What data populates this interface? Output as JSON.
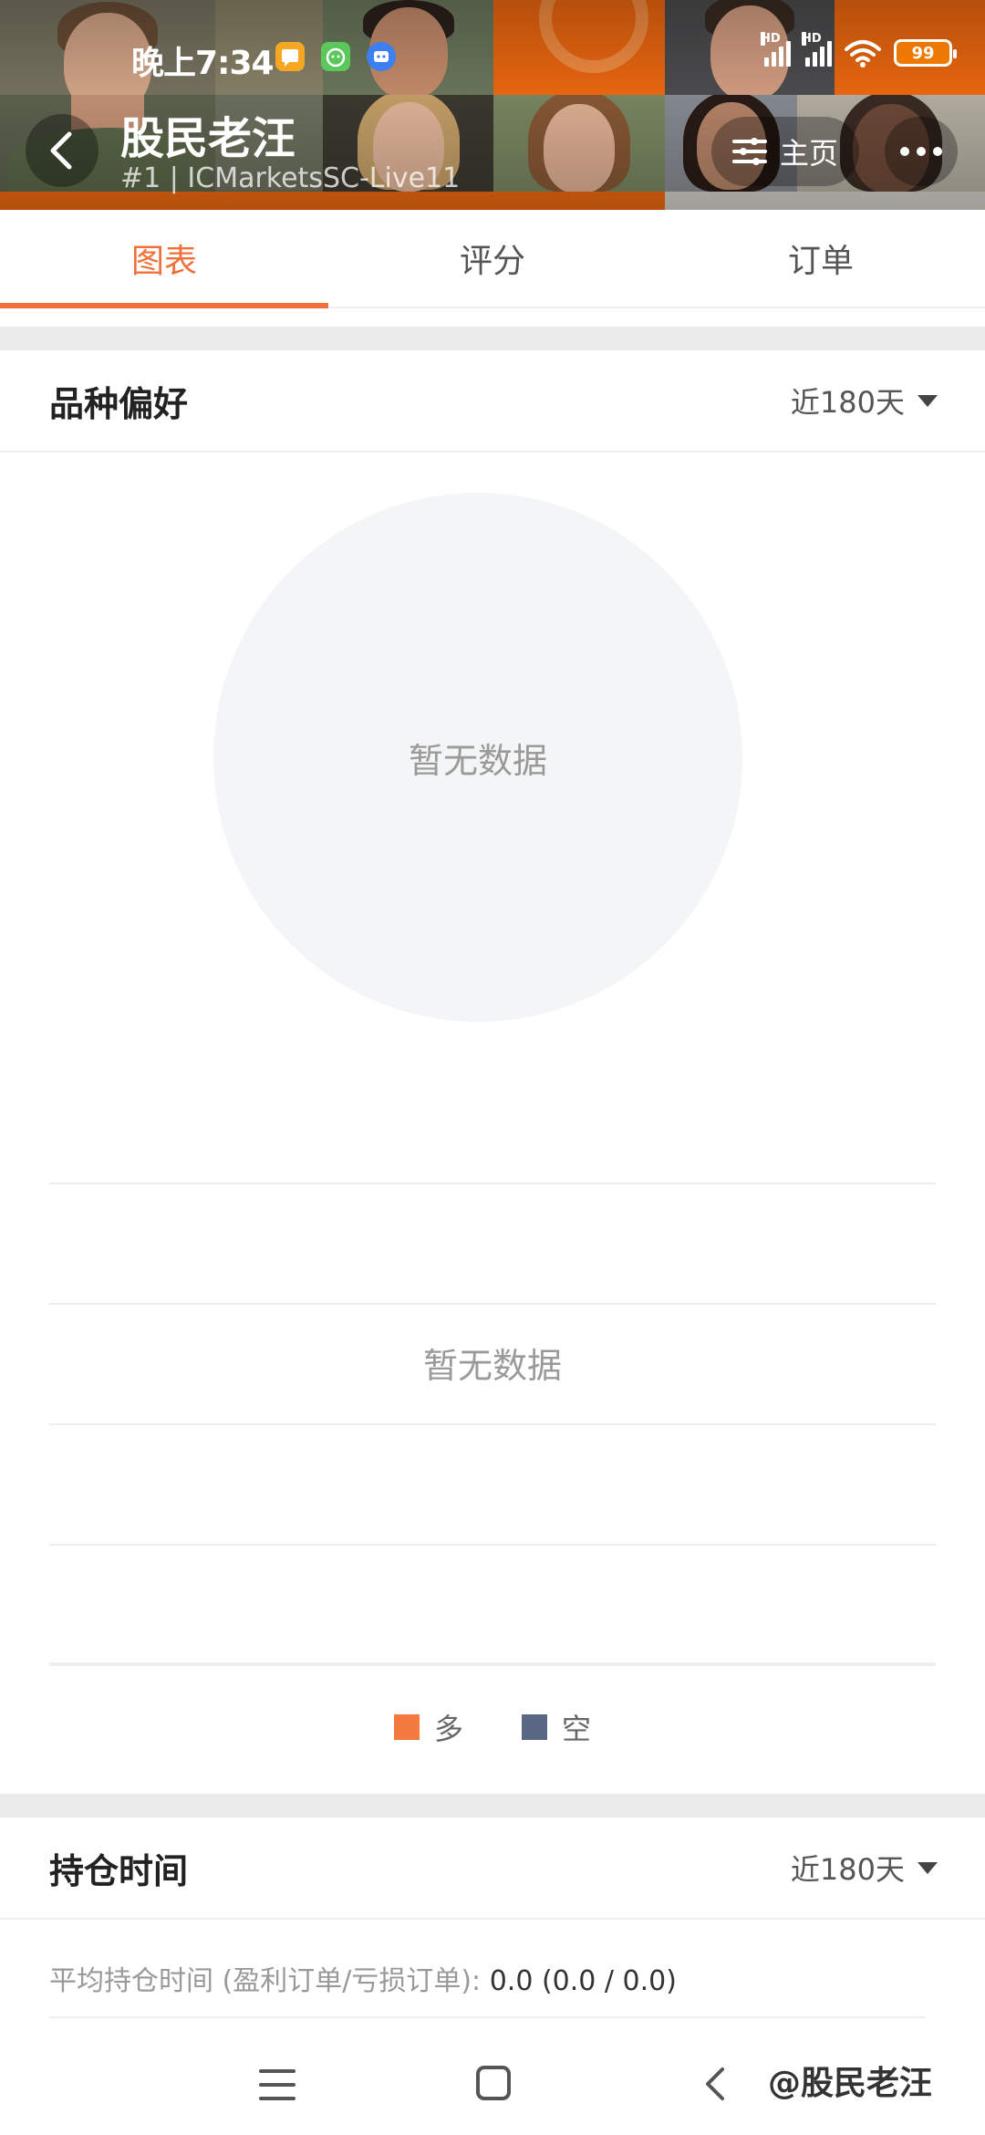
{
  "status_bar": {
    "time": "晚上7:34",
    "signal_1_label": "HD",
    "signal_2_label": "HD",
    "battery": "99",
    "icons": [
      "message-icon",
      "android-icon",
      "robot-app-icon",
      "signal-icon",
      "wifi-icon",
      "battery-icon"
    ]
  },
  "header": {
    "title": "股民老汪",
    "subtitle": "#1 | ICMarketsSC-Live11",
    "home_label": "主页"
  },
  "tabs": [
    {
      "label": "图表",
      "active": true
    },
    {
      "label": "评分",
      "active": false
    },
    {
      "label": "订单",
      "active": false
    }
  ],
  "variety_preference": {
    "title": "品种偏好",
    "range_label": "近180天",
    "pie_empty": "暂无数据",
    "bar_empty": "暂无数据",
    "legend": [
      {
        "label": "多",
        "color": "#f47a40"
      },
      {
        "label": "空",
        "color": "#5a6783"
      }
    ]
  },
  "holding_time": {
    "title": "持仓时间",
    "range_label": "近180天",
    "avg_label": "平均持仓时间 (盈利订单/亏损订单):",
    "avg_value": "0.0 (0.0 / 0.0)"
  },
  "watermark": "@股民老汪",
  "colors": {
    "accent": "#f0703a",
    "header_orange": "#f26a10"
  }
}
